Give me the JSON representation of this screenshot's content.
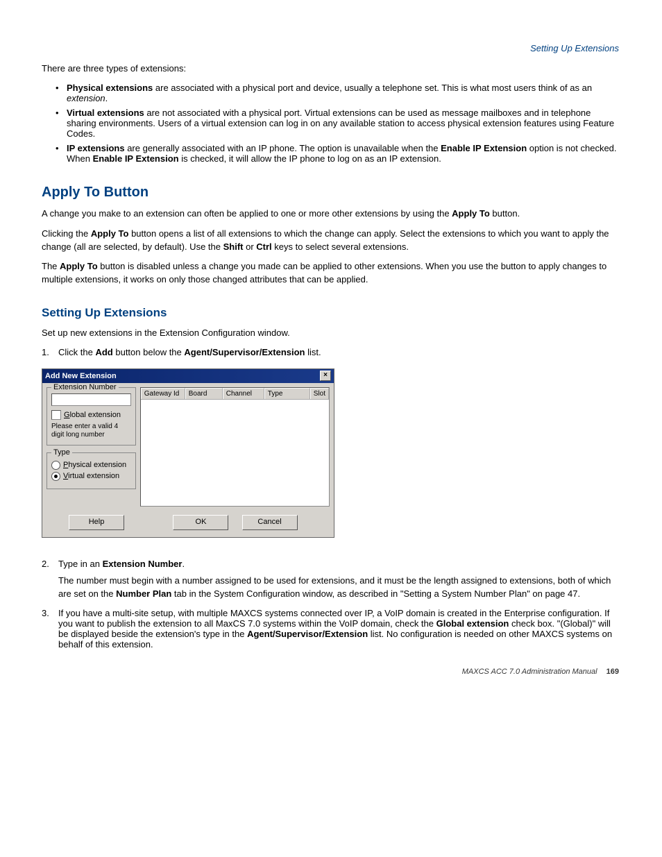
{
  "header": {
    "right": "Setting Up Extensions"
  },
  "intro": {
    "line": "There are three types of extensions:"
  },
  "bullets": {
    "b1": {
      "lead": "Physical extensions",
      "rest": " are associated with a physical port and device, usually a telephone set. This is what most users think of as an ",
      "em": "extension",
      "end": "."
    },
    "b2": {
      "lead": "Virtual extensions",
      "rest": " are not associated with a physical port. Virtual extensions can be used as message mailboxes and in telephone sharing environments. Users of a virtual extension can log in on any available station to access physical extension features using Feature Codes."
    },
    "b3": {
      "lead": "IP extensions",
      "rest1": " are generally associated with an IP phone. The option is unavailable when the ",
      "em1": "Enable IP Extension",
      "rest2": " option is not checked. When ",
      "em2": "Enable IP Extension",
      "rest3": " is checked, it will allow the IP phone to log on as an IP extension."
    }
  },
  "apply_h2": "Apply To Button",
  "apply": {
    "p1a": "A change you make to an extension can often be applied to one or more other extensions by using the ",
    "p1b": "Apply To",
    "p1c": " button.",
    "p2a": "Clicking the ",
    "p2b": "Apply To",
    "p2c": " button opens a list of all extensions to which the change can apply. Select the extensions to which you want to apply the change (all are selected, by default). Use the ",
    "p2d": "Shift",
    "p2e": " or ",
    "p2f": "Ctrl",
    "p2g": " keys to select several extensions.",
    "p3a": "The ",
    "p3b": "Apply To",
    "p3c": " button is disabled unless a change you made can be applied to other extensions. When you use the button to apply changes to multiple extensions, it works on only those changed attributes that can be applied."
  },
  "setup_h2": "Setting Up Extensions",
  "setup_intro": "Set up new extensions in the Extension Configuration window.",
  "steps": {
    "s1": {
      "num": "1.",
      "a": "Click the ",
      "b": "Add",
      "c": " button below the ",
      "d": "Agent/Supervisor/Extension",
      "e": " list."
    },
    "s2": {
      "num": "2.",
      "a": "Type in an ",
      "b": "Extension Number",
      "c": ".",
      "sub1a": "The number must begin with a number assigned to be used for extensions, and it must be the length assigned to extensions, both of which are set on the ",
      "sub1b": "Number Plan",
      "sub1c": " tab in the System Configuration window, as described in \"Setting a System Number Plan\" on page 47."
    },
    "s3": {
      "num": "3.",
      "a": "If you have a multi-site setup, with multiple MAXCS systems connected over IP, a VoIP domain is created in the Enterprise configuration. If you want to publish the extension to all MaxCS 7.0  systems within the VoIP domain, check the ",
      "b": "Global extension",
      "c": " check box. \"(Global)\" will be displayed beside the extension's type in the ",
      "d": "Agent/Supervisor/Extension",
      "e": " list. No configuration is needed on other MAXCS systems on behalf of this extension."
    }
  },
  "dialog": {
    "title": "Add New Extension",
    "close": "×",
    "grp_ext": "Extension Number",
    "cb_global": "Global extension",
    "hint": "Please enter a valid 4 digit long number",
    "grp_type": "Type",
    "rb_phys": "Physical extension",
    "rb_virt": "Virtual extension",
    "th_gw": "Gateway Id",
    "th_bd": "Board",
    "th_ch": "Channel",
    "th_ty": "Type",
    "th_sl": "Slot",
    "btn_help": "Help",
    "btn_ok": "OK",
    "btn_cancel": "Cancel"
  },
  "footer": {
    "text": "MAXCS ACC 7.0 Administration Manual",
    "page": "169"
  }
}
